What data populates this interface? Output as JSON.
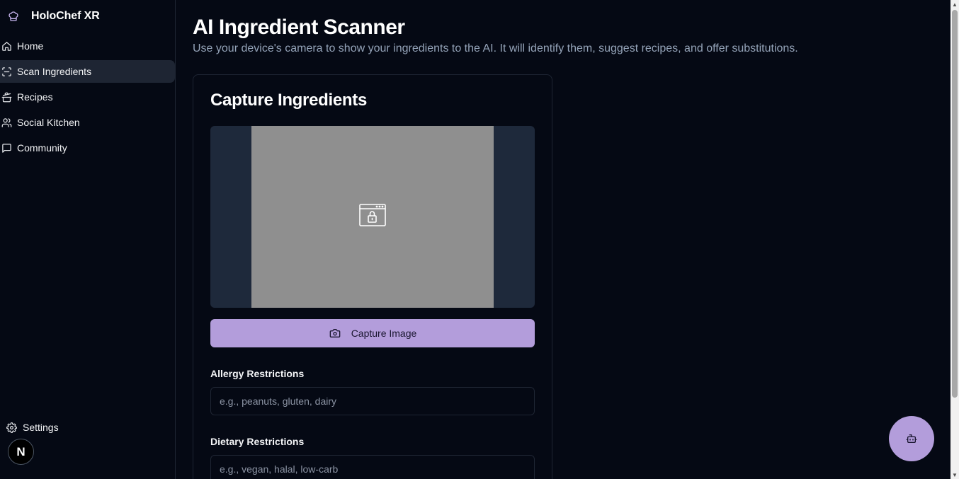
{
  "sidebar": {
    "brand": "HoloChef XR",
    "items": [
      {
        "label": "Home",
        "icon": "home-icon",
        "active": false
      },
      {
        "label": "Scan Ingredients",
        "icon": "scan-icon",
        "active": true
      },
      {
        "label": "Recipes",
        "icon": "cooking-pot-icon",
        "active": false
      },
      {
        "label": "Social Kitchen",
        "icon": "users-icon",
        "active": false
      },
      {
        "label": "Community",
        "icon": "message-square-icon",
        "active": false
      }
    ],
    "settings_label": "Settings",
    "badge_letter": "N"
  },
  "main": {
    "title": "AI Ingredient Scanner",
    "subtitle": "Use your device's camera to show your ingredients to the AI. It will identify them, suggest recipes, and offer substitutions."
  },
  "card": {
    "title": "Capture Ingredients",
    "camera_placeholder_icon": "browser-lock-icon",
    "capture_button": "Capture Image",
    "allergy_label": "Allergy Restrictions",
    "allergy_placeholder": "e.g., peanuts, gluten, dairy",
    "allergy_value": "",
    "dietary_label": "Dietary Restrictions",
    "dietary_placeholder": "e.g., vegan, halal, low-carb",
    "dietary_value": ""
  },
  "fab": {
    "icon": "bot-icon"
  },
  "colors": {
    "background": "#050914",
    "accent": "#b39ddb",
    "active_nav": "#1e2533",
    "camera_frame": "#8f8f8f",
    "camera_bg": "#1e293b"
  }
}
